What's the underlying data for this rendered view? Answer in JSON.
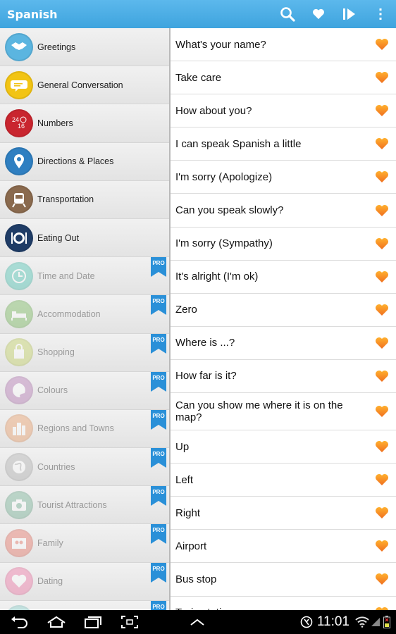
{
  "app": {
    "title": "Spanish",
    "actions": [
      "search-icon",
      "heart-icon",
      "play-icon",
      "overflow-menu-icon"
    ]
  },
  "categories": [
    {
      "label": "Greetings",
      "icon": "handshake-icon",
      "color": "#5bb5e0",
      "locked": false
    },
    {
      "label": "General Conversation",
      "icon": "speech-bubble-icon",
      "color": "#f2c414",
      "locked": false
    },
    {
      "label": "Numbers",
      "icon": "numbers-icon",
      "color": "#c9252f",
      "locked": false
    },
    {
      "label": "Directions & Places",
      "icon": "map-pin-icon",
      "color": "#2f7fc1",
      "locked": false
    },
    {
      "label": "Transportation",
      "icon": "train-icon",
      "color": "#8a6a4e",
      "locked": false
    },
    {
      "label": "Eating Out",
      "icon": "plate-cutlery-icon",
      "color": "#1f3c66",
      "locked": false
    },
    {
      "label": "Time and Date",
      "icon": "clock-icon",
      "color": "#55c7b7",
      "locked": true
    },
    {
      "label": "Accommodation",
      "icon": "bed-icon",
      "color": "#7dbb63",
      "locked": true
    },
    {
      "label": "Shopping",
      "icon": "shopping-bag-icon",
      "color": "#c5d36a",
      "locked": true
    },
    {
      "label": "Colours",
      "icon": "palette-icon",
      "color": "#b97fb8",
      "locked": true
    },
    {
      "label": "Regions and Towns",
      "icon": "city-icon",
      "color": "#eba270",
      "locked": true
    },
    {
      "label": "Countries",
      "icon": "globe-icon",
      "color": "#b5b5b5",
      "locked": true
    },
    {
      "label": "Tourist Attractions",
      "icon": "camera-icon",
      "color": "#7cb59a",
      "locked": true
    },
    {
      "label": "Family",
      "icon": "family-photo-icon",
      "color": "#e87a6c",
      "locked": true
    },
    {
      "label": "Dating",
      "icon": "heart-icon",
      "color": "#f07ca9",
      "locked": true
    },
    {
      "label": "",
      "icon": "category-icon",
      "color": "#8fd0cc",
      "locked": true
    }
  ],
  "pro_badge": "PRO",
  "phrases": [
    "What's your name?",
    "Take care",
    "How about you?",
    "I can speak Spanish a little",
    "I'm sorry (Apologize)",
    "Can you speak slowly?",
    "I'm sorry (Sympathy)",
    "It's alright (I'm ok)",
    "Zero",
    "Where is ...?",
    "How far is it?",
    "Can you show me where it is on the map?",
    "Up",
    "Left",
    "Right",
    "Airport",
    "Bus stop",
    "Train station"
  ],
  "status": {
    "time": "11:01"
  },
  "colors": {
    "action_bar": "#3ea4de",
    "favorite_heart": "#f07020",
    "pro_badge": "#2a90d8"
  }
}
